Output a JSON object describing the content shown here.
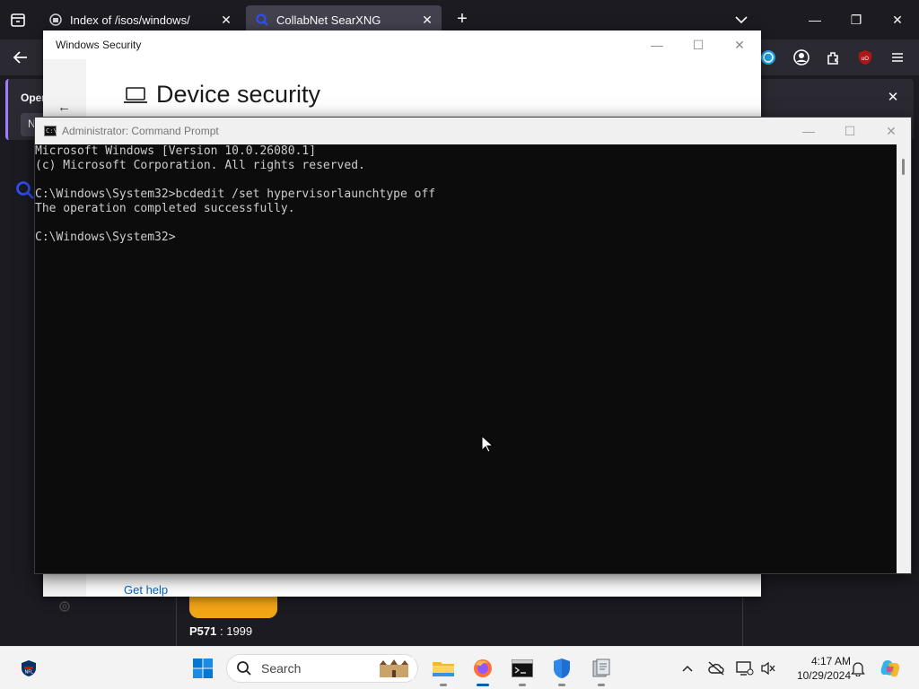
{
  "browser": {
    "tabs": [
      {
        "title": "Index of /isos/windows/",
        "icon": "directory-icon",
        "active": false
      },
      {
        "title": "CollabNet SearXNG",
        "icon": "searxng-icon",
        "active": true
      }
    ],
    "notification": {
      "text": "Oper",
      "button_label": "N"
    },
    "result": {
      "label": "P571",
      "value": " : 1999"
    }
  },
  "windows_security": {
    "window_title": "Windows Security",
    "page_title": "Device security",
    "help_link": "Get help"
  },
  "cmd": {
    "window_title": "Administrator: Command Prompt",
    "icon_text": "C:\\",
    "lines": [
      "Microsoft Windows [Version 10.0.26080.1]",
      "(c) Microsoft Corporation. All rights reserved.",
      "",
      "C:\\Windows\\System32>bcdedit /set hypervisorlaunchtype off",
      "The operation completed successfully.",
      "",
      "C:\\Windows\\System32>"
    ]
  },
  "taskbar": {
    "search_label": "Search",
    "clock_time": "4:17 AM",
    "clock_date": "10/29/2024"
  },
  "colors": {
    "browser_bg": "#1c1b22",
    "cmd_bg": "#0c0c0c",
    "cmd_text": "#cccccc",
    "accent": "#005fb8",
    "link": "#0067c0"
  }
}
